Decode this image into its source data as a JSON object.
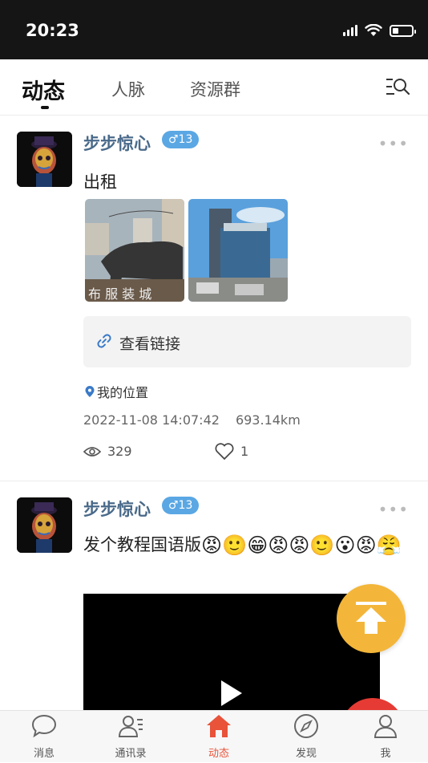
{
  "status_bar": {
    "time": "20:23",
    "battery_level": 0.3
  },
  "tabs": [
    {
      "label": "动态",
      "active": true
    },
    {
      "label": "人脉",
      "active": false
    },
    {
      "label": "资源群",
      "active": false
    }
  ],
  "posts": [
    {
      "username": "步步惊心",
      "gender_age": "♂13",
      "text": "出租",
      "images": [
        "bull-statue-photo",
        "office-building-photo"
      ],
      "link_label": "查看链接",
      "location": "我的位置",
      "datetime": "2022-11-08 14:07:42",
      "distance": "693.14km",
      "views": "329",
      "likes": "1"
    },
    {
      "username": "步步惊心",
      "gender_age": "♂13",
      "text": "发个教程国语版",
      "emojis": [
        "😡",
        "🙂",
        "😁",
        "😡",
        "😡",
        "🙂",
        "😮",
        "😡",
        "😤"
      ]
    }
  ],
  "bottom_nav": [
    {
      "label": "消息",
      "icon": "chat-bubble-icon",
      "active": false
    },
    {
      "label": "通讯录",
      "icon": "contacts-icon",
      "active": false
    },
    {
      "label": "动态",
      "icon": "home-icon",
      "active": true
    },
    {
      "label": "发现",
      "icon": "compass-icon",
      "active": false
    },
    {
      "label": "我",
      "icon": "person-icon",
      "active": false
    }
  ],
  "colors": {
    "accent": "#e8533a",
    "username": "#4a6a8a",
    "gender_badge": "#5aa7e4",
    "fab_top": "#f3b63a",
    "fab_red": "#e53b34"
  }
}
